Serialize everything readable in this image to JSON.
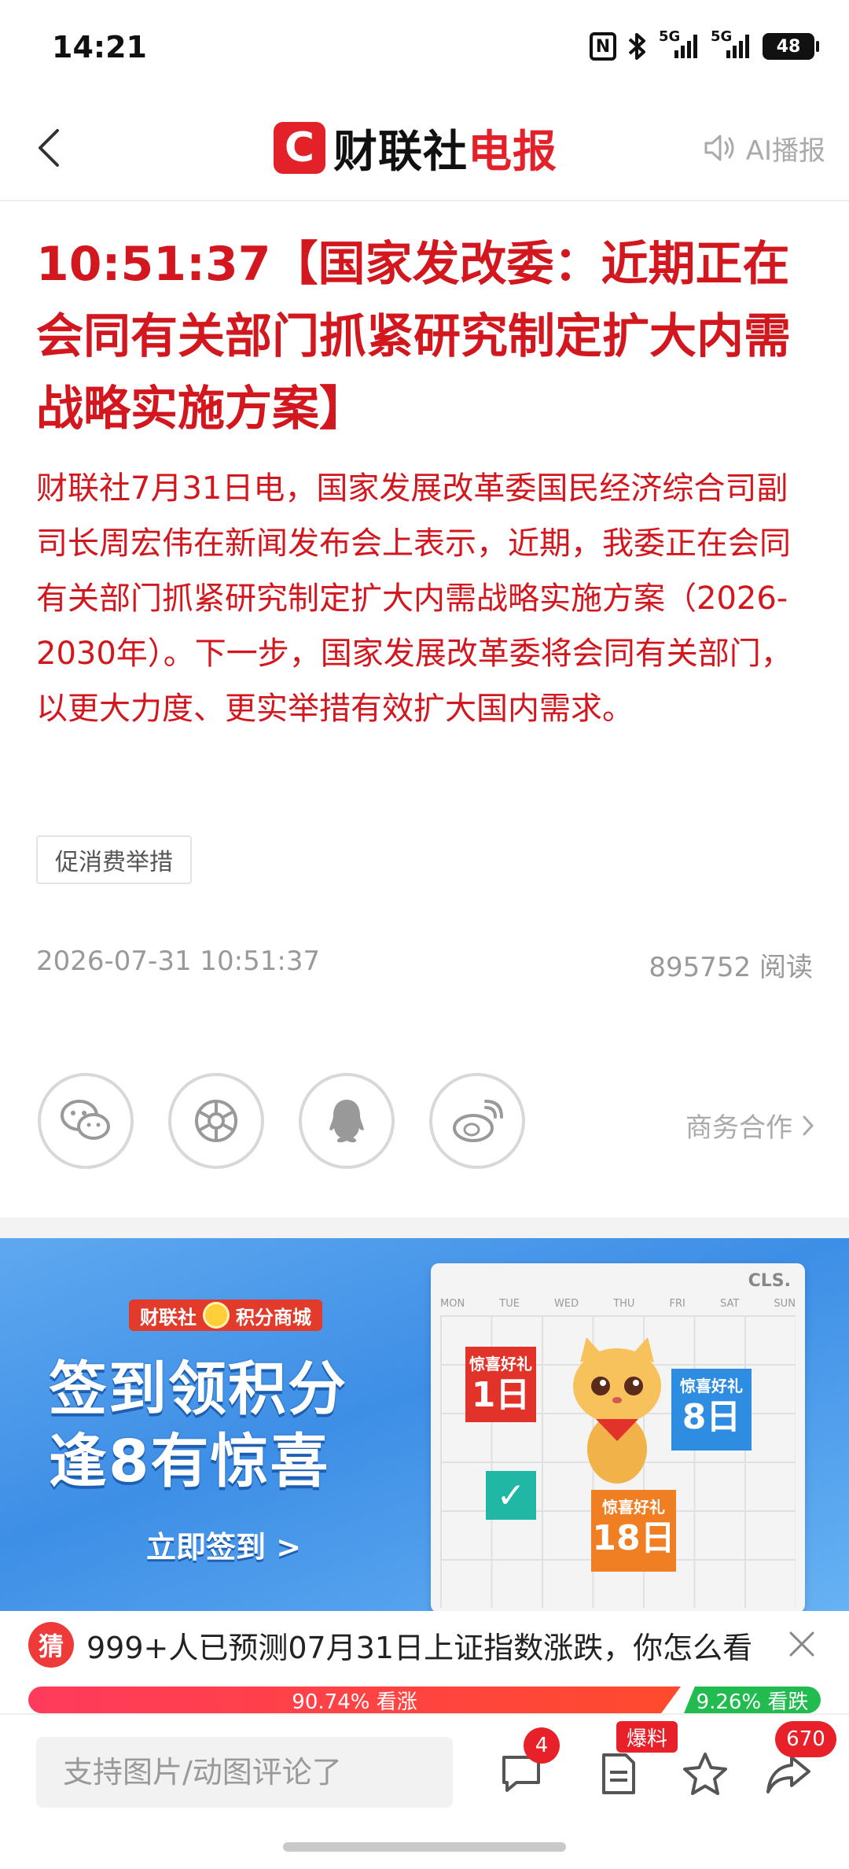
{
  "status_bar": {
    "time": "14:21",
    "nfc": "N",
    "sig1": "5G",
    "sig2": "5G",
    "battery": "48"
  },
  "header": {
    "logo_mark": "C",
    "logo_text": "财联社",
    "logo_accent": "电报",
    "ai_label": "AI播报"
  },
  "article": {
    "headline": "10:51:37【国家发改委：近期正在会同有关部门抓紧研究制定扩大内需战略实施方案】",
    "body": "财联社7月31日电，国家发展改革委国民经济综合司副司长周宏伟在新闻发布会上表示，近期，我委正在会同有关部门抓紧研究制定扩大内需战略实施方案（2026-2030年）。下一步，国家发展改革委将会同有关部门，以更大力度、更实举措有效扩大国内需求。",
    "tag": "促消费举措",
    "datetime": "2026-07-31 10:51:37",
    "reads": "895752 阅读"
  },
  "share": {
    "business_link": "商务合作"
  },
  "banner": {
    "badge_brand": "财联社",
    "badge_mall": "积分商城",
    "title_line1": "签到领积分",
    "title_line2": "逢8有惊喜",
    "cta": "立即签到 >",
    "cal_brand": "CLS.",
    "weekdays": [
      "MON",
      "TUE",
      "WED",
      "THU",
      "FRI",
      "SAT",
      "SUN"
    ],
    "card_label": "惊喜好礼",
    "day1": "1日",
    "day8": "8日",
    "day18": "18日"
  },
  "prediction": {
    "icon_text": "猜",
    "text": "999+人已预测07月31日上证指数涨跌，你怎么看",
    "up_label": "90.74% 看涨",
    "up_fraction": 0.9074,
    "down_label": "9.26% 看跌",
    "down_fraction": 0.0926
  },
  "bottom_bar": {
    "comment_placeholder": "支持图片/动图评论了",
    "comment_count": "4",
    "tipoff_label": "爆料",
    "share_count": "670"
  },
  "colors": {
    "accent_red": "#d2171e",
    "brand_red": "#e32129",
    "up_red": "#ff3b5c",
    "down_green": "#22bb4f"
  }
}
